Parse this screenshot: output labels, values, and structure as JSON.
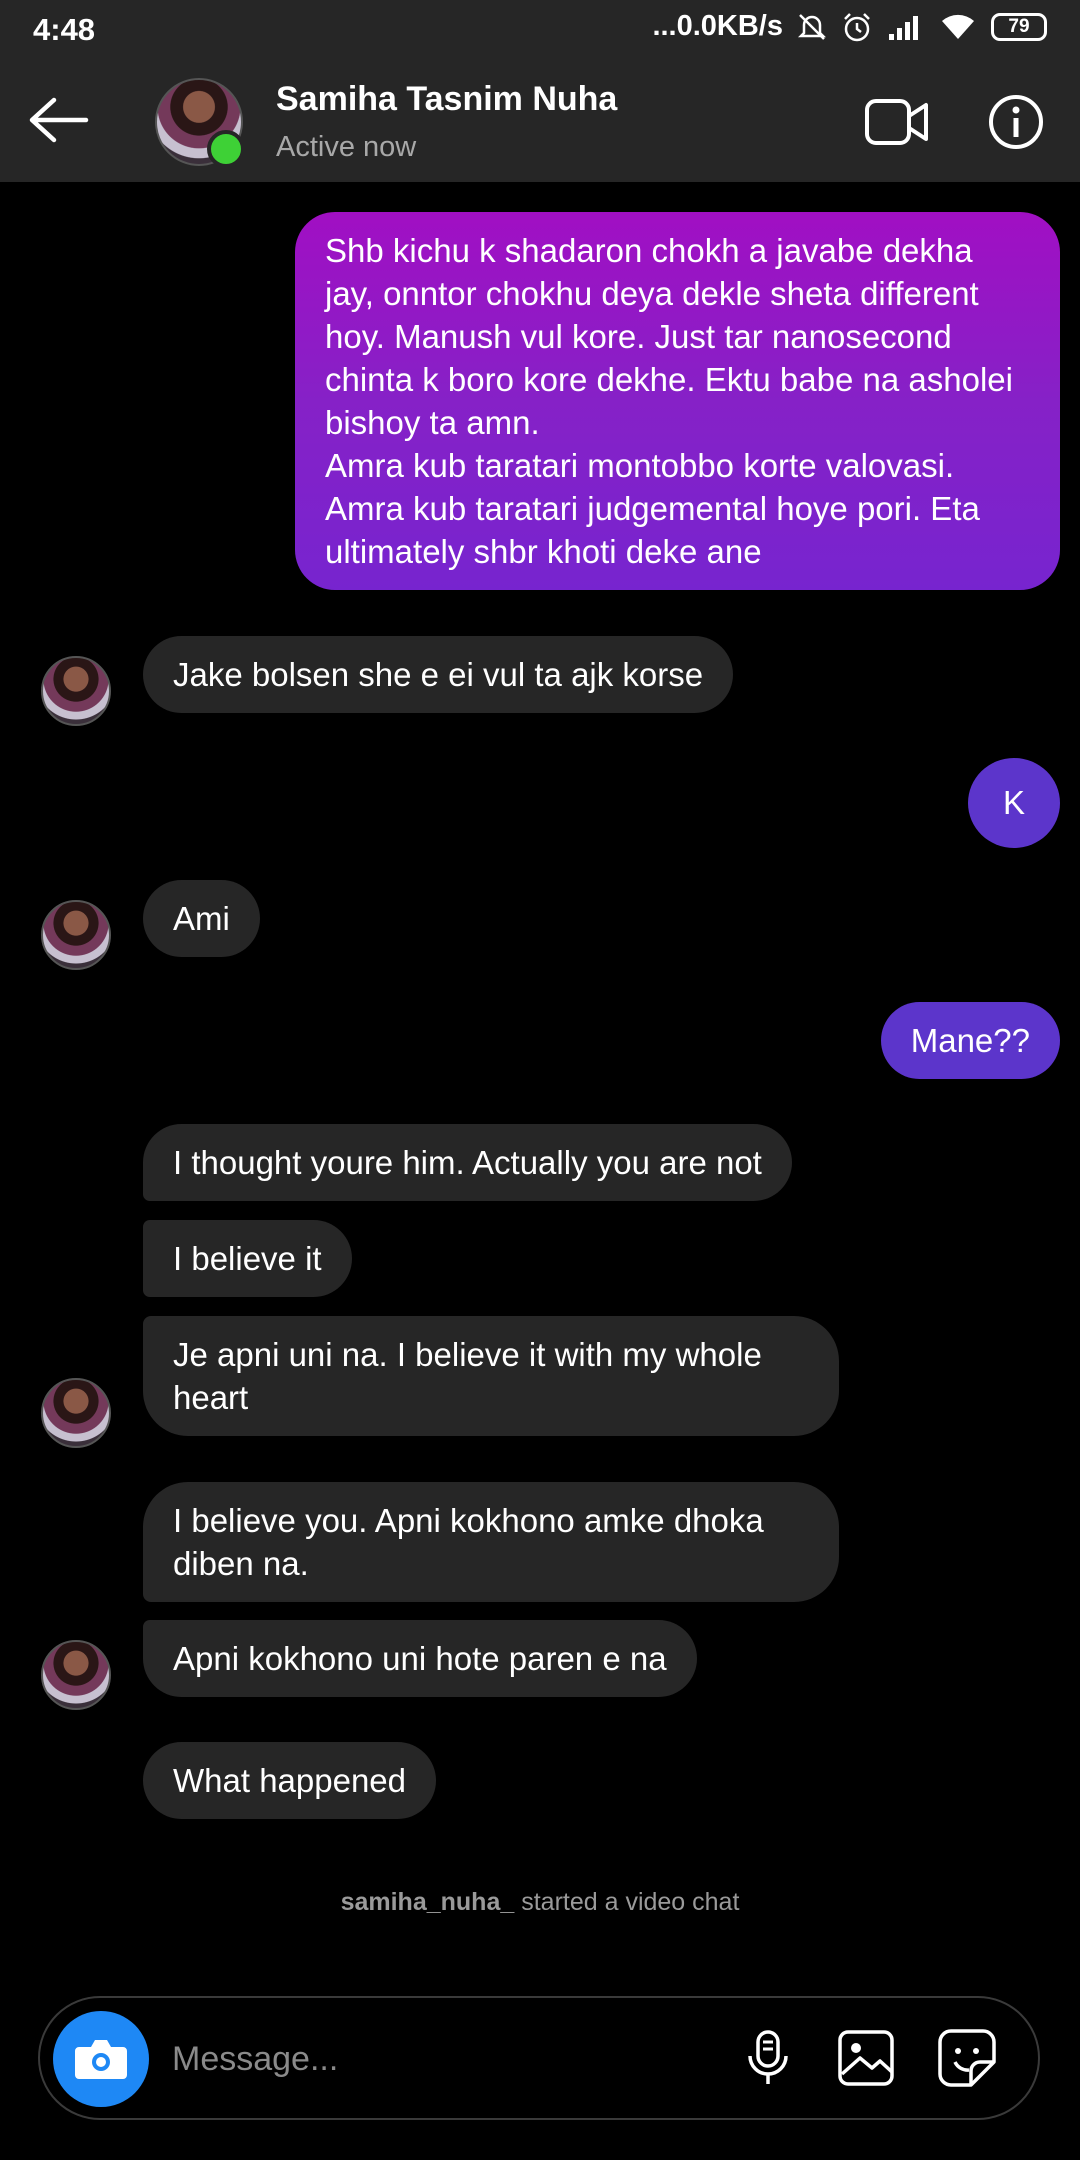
{
  "status_bar": {
    "time": "4:48",
    "network_speed": "...0.0KB/s",
    "battery": "79"
  },
  "header": {
    "contact_name": "Samiha Tasnim Nuha",
    "presence": "Active now"
  },
  "messages": [
    {
      "from": "me",
      "text": "Shb kichu k shadaron chokh a javabe dekha jay, onntor chokhu deya dekle sheta different hoy. Manush vul kore. Just tar nanosecond chinta k boro kore dekhe. Ektu babe na asholei bishoy ta amn.\nAmra kub taratari montobbo korte valovasi. Amra kub taratari judgemental hoye pori. Eta ultimately shbr khoti deke ane"
    },
    {
      "from": "them",
      "text": "Jake bolsen she e ei vul ta ajk korse"
    },
    {
      "from": "me",
      "text": "K"
    },
    {
      "from": "them",
      "text": "Ami"
    },
    {
      "from": "me",
      "text": "Mane??"
    },
    {
      "from": "them",
      "text": "I thought youre him. Actually you are not"
    },
    {
      "from": "them",
      "text": "I believe it"
    },
    {
      "from": "them",
      "text": "Je apni uni na. I believe it with my whole heart"
    },
    {
      "from": "them",
      "text": "I believe you. Apni kokhono amke dhoka diben na."
    },
    {
      "from": "them",
      "text": "Apni kokhono uni hote paren e na"
    },
    {
      "from": "them",
      "text": "What happened"
    }
  ],
  "system_note": {
    "username": "samiha_nuha_",
    "action": "started a video chat"
  },
  "composer": {
    "placeholder": "Message..."
  },
  "colors": {
    "accent_gradient_top": "#a10fc3",
    "accent_gradient_bottom": "#7724cf",
    "sent_bubble": "#5c35cb",
    "received_bubble": "#262626",
    "online": "#3ed136",
    "camera_button": "#1e88f5"
  }
}
